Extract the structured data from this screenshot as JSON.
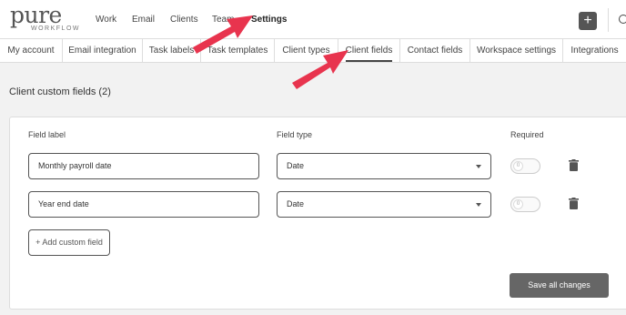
{
  "brand": {
    "name": "pure",
    "tagline": "WORKFLOW"
  },
  "nav": [
    {
      "label": "Work"
    },
    {
      "label": "Email"
    },
    {
      "label": "Clients"
    },
    {
      "label": "Team"
    },
    {
      "label": "Settings"
    }
  ],
  "plus_label": "+",
  "tabs": [
    {
      "label": "My account"
    },
    {
      "label": "Email integration"
    },
    {
      "label": "Task labels"
    },
    {
      "label": "Task templates"
    },
    {
      "label": "Client types"
    },
    {
      "label": "Client fields"
    },
    {
      "label": "Contact fields"
    },
    {
      "label": "Workspace settings"
    },
    {
      "label": "Integrations"
    }
  ],
  "section_title": "Client custom fields (2)",
  "columns": {
    "label": "Field label",
    "type": "Field type",
    "required": "Required"
  },
  "fields": [
    {
      "label": "Monthly payroll date",
      "type": "Date",
      "toggle_text": "0"
    },
    {
      "label": "Year end date",
      "type": "Date",
      "toggle_text": "0"
    }
  ],
  "add_button": "+ Add custom field",
  "save_button": "Save all changes",
  "colors": {
    "annotation_arrow": "#e8344e",
    "save_button": "#666666"
  }
}
